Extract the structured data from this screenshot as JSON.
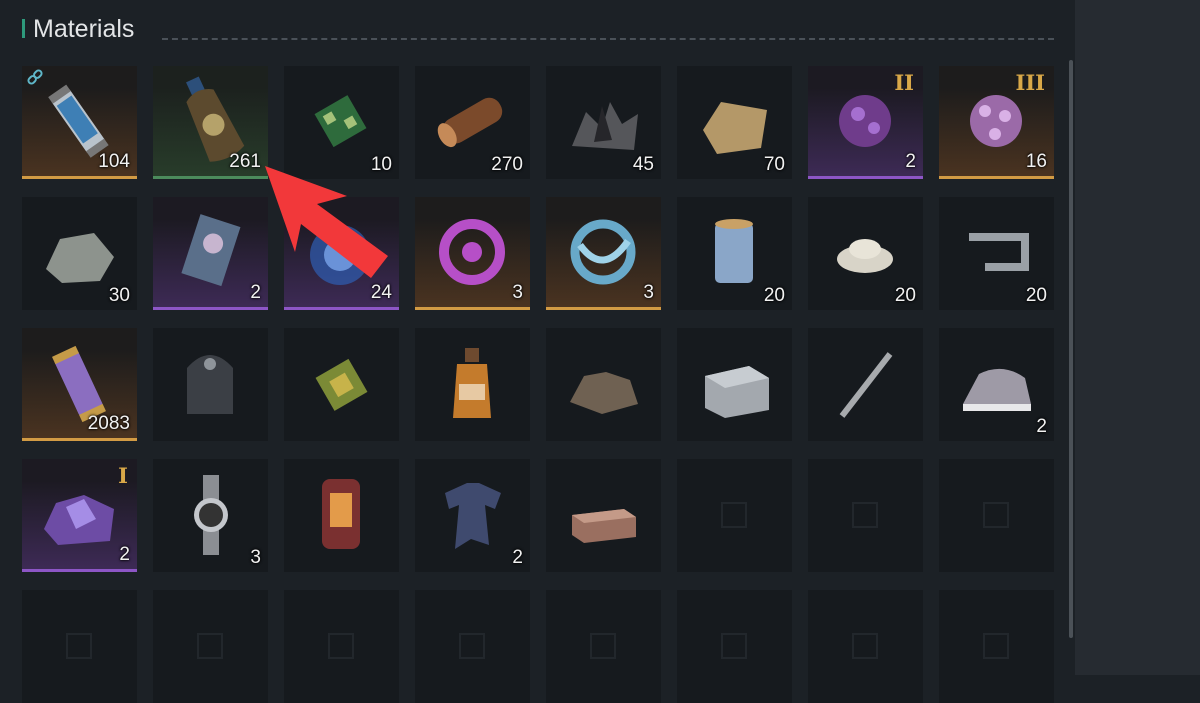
{
  "section_title": "Materials",
  "accent_color": "#2e9a7c",
  "tier_colors": {
    "orange": "#d29b44",
    "green": "#4c8b5c",
    "purple": "#8d56c6"
  },
  "rows": [
    [
      {
        "item": "bottle-capsule",
        "quantity": "104",
        "tier": "orange",
        "linked": true
      },
      {
        "item": "chemical-bottle",
        "quantity": "261",
        "tier": "green"
      },
      {
        "item": "circuit-board",
        "quantity": "10"
      },
      {
        "item": "wood-log",
        "quantity": "270"
      },
      {
        "item": "dark-crystal-ore",
        "quantity": "45"
      },
      {
        "item": "cloth-scrap",
        "quantity": "70"
      },
      {
        "item": "purple-spore-orb",
        "quantity": "2",
        "tier": "purple",
        "rank": "II"
      },
      {
        "item": "spiked-spore-orb",
        "quantity": "16",
        "tier": "orange",
        "rank": "III"
      }
    ],
    [
      {
        "item": "grey-stone",
        "quantity": "30"
      },
      {
        "item": "specimen-card",
        "quantity": "2",
        "tier": "purple"
      },
      {
        "item": "blue-energy-cloud",
        "quantity": "24",
        "tier": "purple"
      },
      {
        "item": "purple-lattice",
        "quantity": "3",
        "tier": "orange"
      },
      {
        "item": "blue-knot",
        "quantity": "3",
        "tier": "orange"
      },
      {
        "item": "fiber-spool",
        "quantity": "20"
      },
      {
        "item": "white-granules",
        "quantity": "20"
      },
      {
        "item": "metal-clip",
        "quantity": "20"
      }
    ],
    [
      {
        "item": "purple-capsule",
        "quantity": "2083",
        "tier": "orange"
      },
      {
        "item": "armor-shell",
        "quantity": ""
      },
      {
        "item": "microchip",
        "quantity": ""
      },
      {
        "item": "medicine-bottle",
        "quantity": ""
      },
      {
        "item": "scrap-pile",
        "quantity": ""
      },
      {
        "item": "metal-crate",
        "quantity": ""
      },
      {
        "item": "metal-pen",
        "quantity": ""
      },
      {
        "item": "clothes-iron",
        "quantity": "2"
      }
    ],
    [
      {
        "item": "violet-ore",
        "quantity": "2",
        "tier": "purple",
        "rank": "I"
      },
      {
        "item": "wristwatch",
        "quantity": "3"
      },
      {
        "item": "red-heater",
        "quantity": ""
      },
      {
        "item": "blue-bodysuit",
        "quantity": "2"
      },
      {
        "item": "leather-block",
        "quantity": ""
      },
      {
        "item": "empty",
        "quantity": ""
      },
      {
        "item": "empty",
        "quantity": ""
      },
      {
        "item": "empty",
        "quantity": ""
      }
    ],
    [
      {
        "item": "empty",
        "quantity": ""
      },
      {
        "item": "empty",
        "quantity": ""
      },
      {
        "item": "empty",
        "quantity": ""
      },
      {
        "item": "empty",
        "quantity": ""
      },
      {
        "item": "empty",
        "quantity": ""
      },
      {
        "item": "empty",
        "quantity": ""
      },
      {
        "item": "empty",
        "quantity": ""
      },
      {
        "item": "empty",
        "quantity": ""
      }
    ]
  ],
  "annotation": {
    "icon": "red-arrow-icon",
    "color": "#f2383a"
  }
}
